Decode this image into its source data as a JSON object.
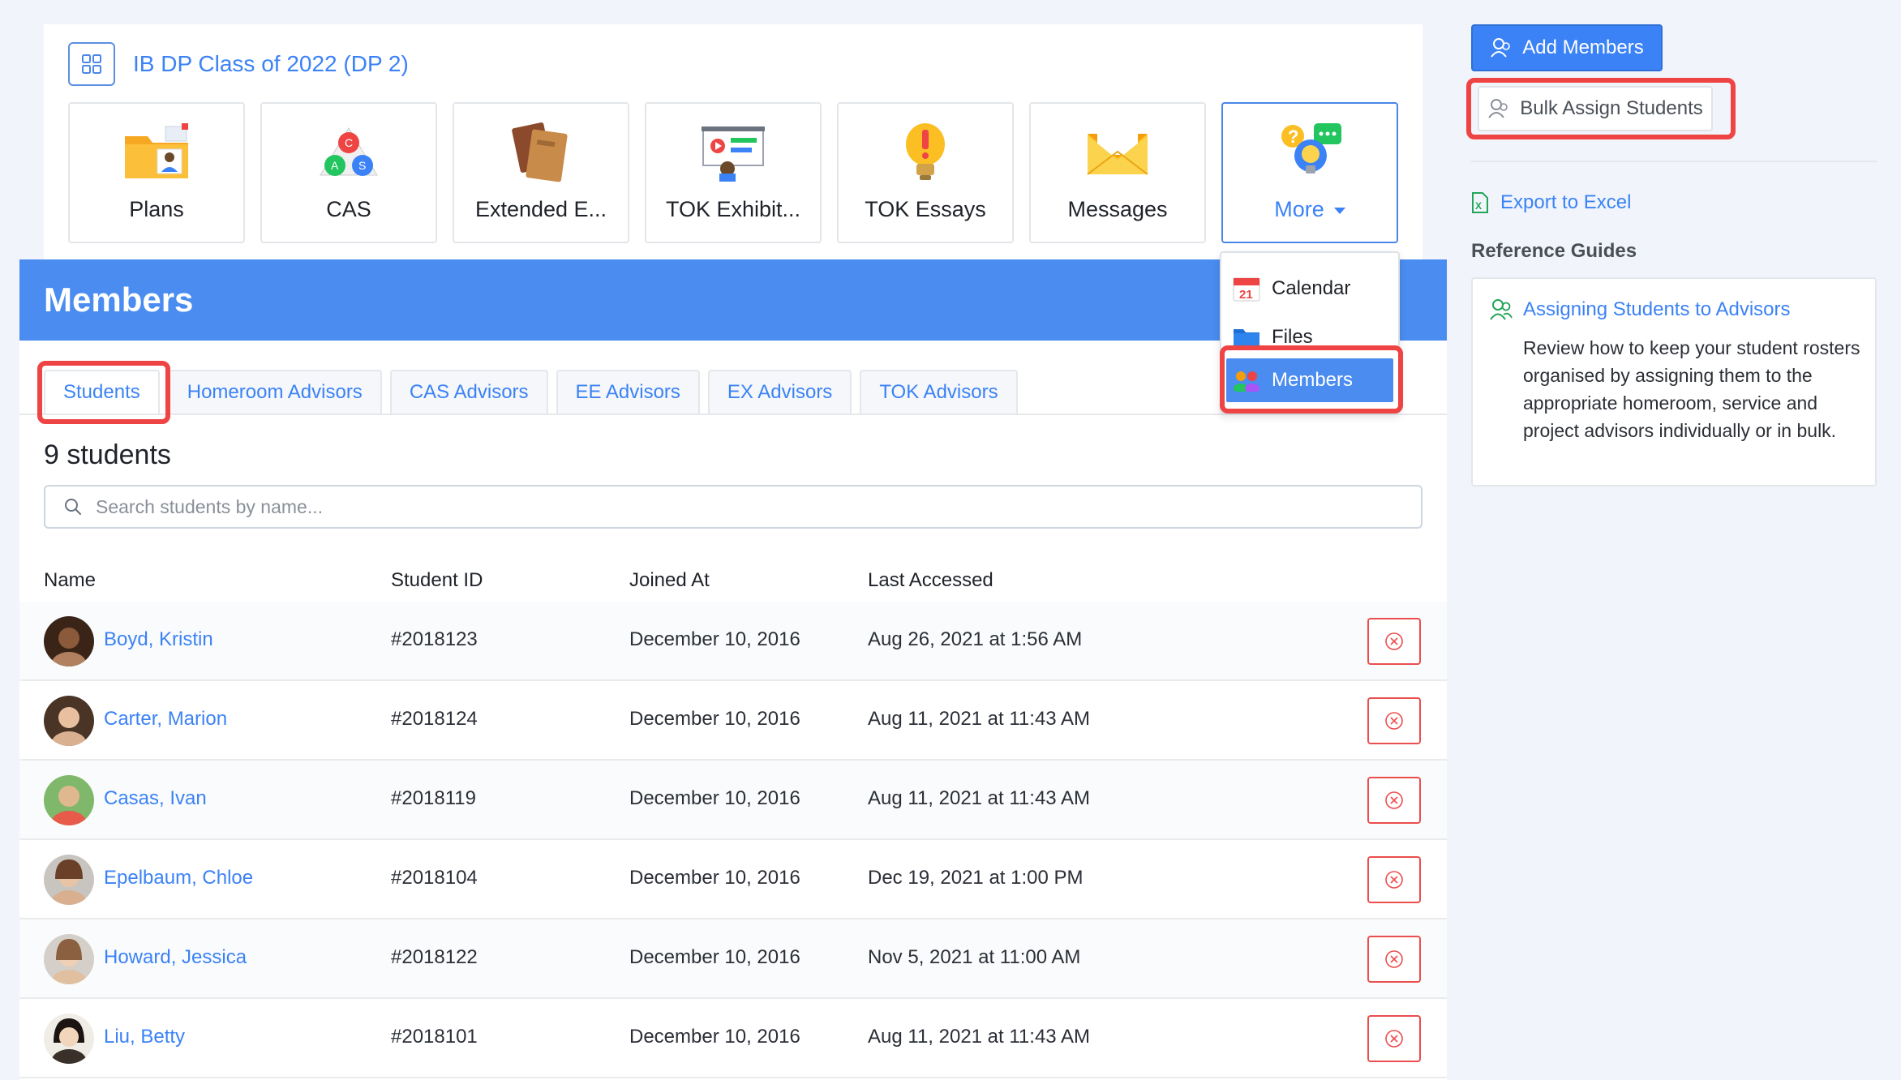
{
  "class_header": {
    "title": "IB DP Class of 2022 (DP 2)"
  },
  "tiles": [
    {
      "label": "Plans",
      "icon": "plans-folder-icon"
    },
    {
      "label": "CAS",
      "icon": "cas-triangle-icon"
    },
    {
      "label": "Extended E...",
      "icon": "extended-essay-books-icon"
    },
    {
      "label": "TOK Exhibit...",
      "icon": "tok-exhibit-presentation-icon"
    },
    {
      "label": "TOK Essays",
      "icon": "tok-essays-lightbulb-icon"
    },
    {
      "label": "Messages",
      "icon": "messages-envelope-icon"
    },
    {
      "label": "More",
      "icon": "more-bulb-icon"
    }
  ],
  "dropdown": {
    "items": [
      {
        "label": "Calendar",
        "icon": "calendar-icon",
        "calendar_day": "21"
      },
      {
        "label": "Files",
        "icon": "folder-icon"
      },
      {
        "label": "Members",
        "icon": "members-icon"
      }
    ]
  },
  "members": {
    "title": "Members",
    "tabs": [
      "Students",
      "Homeroom Advisors",
      "CAS Advisors",
      "EE Advisors",
      "EX Advisors",
      "TOK Advisors"
    ],
    "count": "9 students",
    "search_placeholder": "Search students by name...",
    "columns": [
      "Name",
      "Student ID",
      "Joined At",
      "Last Accessed"
    ],
    "rows": [
      {
        "name": "Boyd, Kristin",
        "id": "#2018123",
        "joined": "December 10, 2016",
        "accessed": "Aug 26, 2021 at 1:56 AM"
      },
      {
        "name": "Carter, Marion",
        "id": "#2018124",
        "joined": "December 10, 2016",
        "accessed": "Aug 11, 2021 at 11:43 AM"
      },
      {
        "name": "Casas, Ivan",
        "id": "#2018119",
        "joined": "December 10, 2016",
        "accessed": "Aug 11, 2021 at 11:43 AM"
      },
      {
        "name": "Epelbaum, Chloe",
        "id": "#2018104",
        "joined": "December 10, 2016",
        "accessed": "Dec 19, 2021 at 1:00 PM"
      },
      {
        "name": "Howard, Jessica",
        "id": "#2018122",
        "joined": "December 10, 2016",
        "accessed": "Nov 5, 2021 at 11:00 AM"
      },
      {
        "name": "Liu, Betty",
        "id": "#2018101",
        "joined": "December 10, 2016",
        "accessed": "Aug 11, 2021 at 11:43 AM"
      }
    ]
  },
  "sidebar": {
    "add_members": "Add Members",
    "bulk_assign": "Bulk Assign Students",
    "export": "Export to Excel",
    "reference_title": "Reference Guides",
    "guide_link": "Assigning Students to Advisors",
    "guide_text": "Review how to keep your student rosters organised by assigning them to the appropriate homeroom, service and project advisors individually or in bulk."
  },
  "colors": {
    "primary": "#3b82f6",
    "header_blue": "#4a8cf0",
    "highlight_red": "#ef4444",
    "excel_green": "#22a559"
  }
}
